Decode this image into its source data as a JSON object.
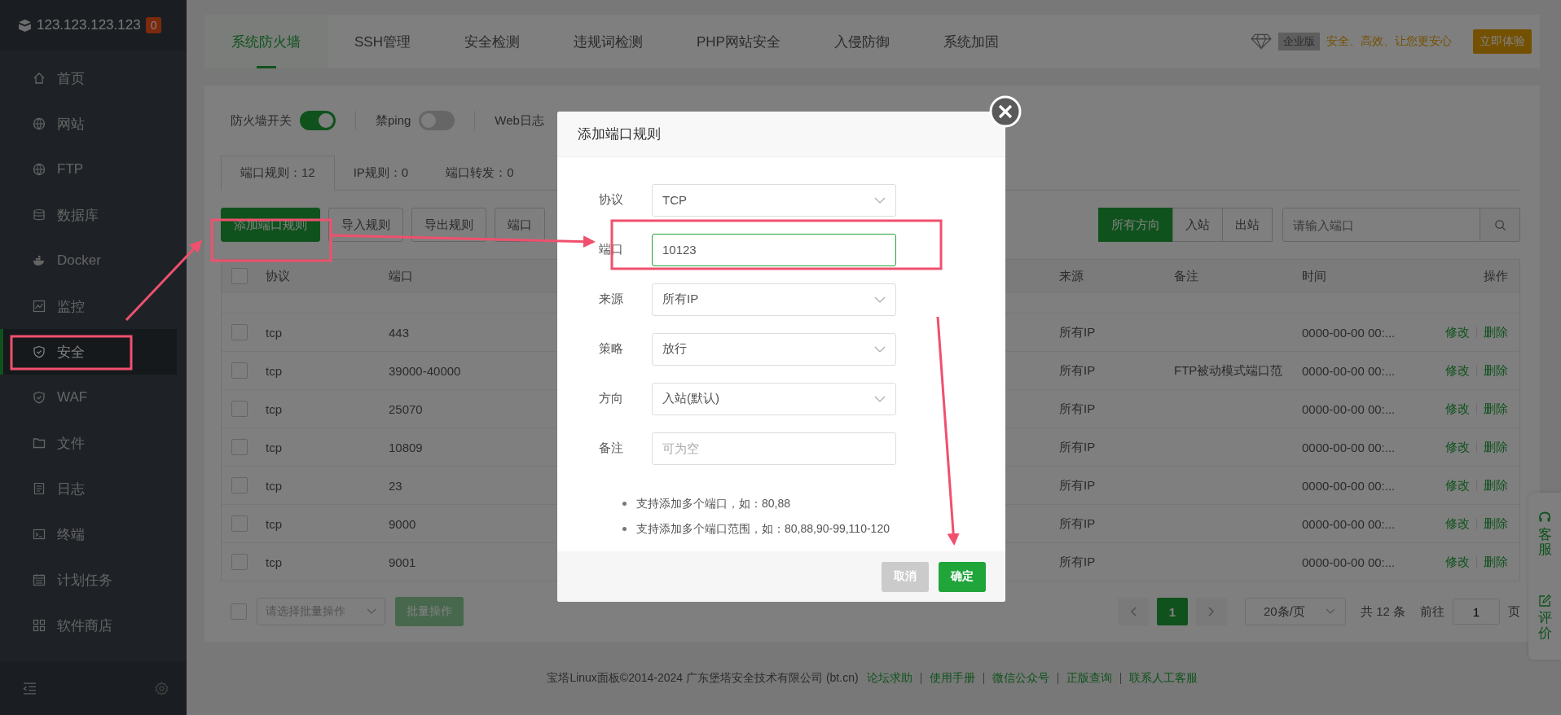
{
  "sidebar": {
    "server": "123.123.123.123",
    "badge": "0",
    "items": [
      {
        "label": "首页",
        "selected": false
      },
      {
        "label": "网站",
        "selected": false
      },
      {
        "label": "FTP",
        "selected": false
      },
      {
        "label": "数据库",
        "selected": false
      },
      {
        "label": "Docker",
        "selected": false
      },
      {
        "label": "监控",
        "selected": false
      },
      {
        "label": "安全",
        "selected": true
      },
      {
        "label": "WAF",
        "selected": false
      },
      {
        "label": "文件",
        "selected": false
      },
      {
        "label": "日志",
        "selected": false
      },
      {
        "label": "终端",
        "selected": false
      },
      {
        "label": "计划任务",
        "selected": false
      },
      {
        "label": "软件商店",
        "selected": false
      }
    ]
  },
  "tabs": [
    {
      "label": "系统防火墙",
      "selected": true
    },
    {
      "label": "SSH管理",
      "selected": false
    },
    {
      "label": "安全检测",
      "selected": false
    },
    {
      "label": "违规词检测",
      "selected": false
    },
    {
      "label": "PHP网站安全",
      "selected": false
    },
    {
      "label": "入侵防御",
      "selected": false
    },
    {
      "label": "系统加固",
      "selected": false
    }
  ],
  "promo": {
    "badge": "企业版",
    "text": "安全、高效、让您更安心",
    "button": "立即体验"
  },
  "toggles": [
    {
      "label": "防火墙开关",
      "on": true
    },
    {
      "label": "禁ping",
      "on": false
    }
  ],
  "web_log_label": "Web日志",
  "sub_tabs": [
    {
      "label": "端口规则：12",
      "selected": true
    },
    {
      "label": "IP规则：0",
      "selected": false
    },
    {
      "label": "端口转发：0",
      "selected": false
    }
  ],
  "toolbar": {
    "buttons": [
      {
        "label": "添加端口规则",
        "kind": "primary"
      },
      {
        "label": "导入规则",
        "kind": "default"
      },
      {
        "label": "导出规则",
        "kind": "default"
      },
      {
        "label": "端口",
        "kind": "default"
      }
    ],
    "directions": [
      {
        "label": "所有方向",
        "selected": true
      },
      {
        "label": "入站",
        "selected": false
      },
      {
        "label": "出站",
        "selected": false
      }
    ],
    "search_placeholder": "请输入端口"
  },
  "table": {
    "columns": [
      "协议",
      "端口",
      "来源",
      "备注",
      "时间",
      "操作"
    ],
    "all_checked": false,
    "rows": [
      {
        "checked": false,
        "protocol": "tcp",
        "port": "443",
        "source": "所有IP",
        "time": "0000-00-00 00:...",
        "actions": [
          "修改",
          "删除"
        ]
      },
      {
        "checked": false,
        "protocol": "tcp",
        "port": "39000-40000",
        "source": "所有IP",
        "note": "FTP被动模式端口范",
        "time": "0000-00-00 00:...",
        "actions": [
          "修改",
          "删除"
        ]
      },
      {
        "checked": false,
        "protocol": "tcp",
        "port": "25070",
        "source": "所有IP",
        "time": "0000-00-00 00:...",
        "actions": [
          "修改",
          "删除"
        ]
      },
      {
        "checked": false,
        "protocol": "tcp",
        "port": "10809",
        "source": "所有IP",
        "time": "0000-00-00 00:...",
        "actions": [
          "修改",
          "删除"
        ]
      },
      {
        "checked": false,
        "protocol": "tcp",
        "port": "23",
        "source": "所有IP",
        "time": "0000-00-00 00:...",
        "actions": [
          "修改",
          "删除"
        ]
      },
      {
        "checked": false,
        "protocol": "tcp",
        "port": "9000",
        "source": "所有IP",
        "time": "0000-00-00 00:...",
        "actions": [
          "修改",
          "删除"
        ]
      },
      {
        "checked": false,
        "protocol": "tcp",
        "port": "9001",
        "source": "所有IP",
        "time": "0000-00-00 00:...",
        "actions": [
          "修改",
          "删除"
        ]
      }
    ]
  },
  "batch": {
    "checked": false,
    "placeholder": "请选择批量操作",
    "button": "批量操作"
  },
  "pagination": {
    "current": "1",
    "page_size": "20条/页",
    "total": "共 12 条",
    "goto_label": "前往",
    "goto_value": "1",
    "page_suffix": "页"
  },
  "footer": {
    "copyright": "宝塔Linux面板©2014-2024 广东堡塔安全技术有限公司 (bt.cn)",
    "links": [
      "论坛求助",
      "使用手册",
      "微信公众号",
      "正版查询",
      "联系人工客服"
    ]
  },
  "side_widget": [
    {
      "label": "客服"
    },
    {
      "label": "评价"
    }
  ],
  "modal": {
    "title": "添加端口规则",
    "fields": [
      {
        "label": "协议",
        "kind": "select",
        "value": "TCP"
      },
      {
        "label": "端口",
        "kind": "input",
        "value": "10123",
        "focused": true
      },
      {
        "label": "来源",
        "kind": "select",
        "value": "所有IP"
      },
      {
        "label": "策略",
        "kind": "select",
        "value": "放行"
      },
      {
        "label": "方向",
        "kind": "select",
        "value": "入站(默认)"
      },
      {
        "label": "备注",
        "kind": "input",
        "placeholder": "可为空",
        "focused": false
      }
    ],
    "notes": [
      "支持添加多个端口，如：80,88",
      "支持添加多个端口范围，如：80,88,90-99,110-120"
    ],
    "buttons": [
      {
        "label": "取消",
        "kind": "cancel"
      },
      {
        "label": "确定",
        "kind": "confirm"
      }
    ]
  }
}
